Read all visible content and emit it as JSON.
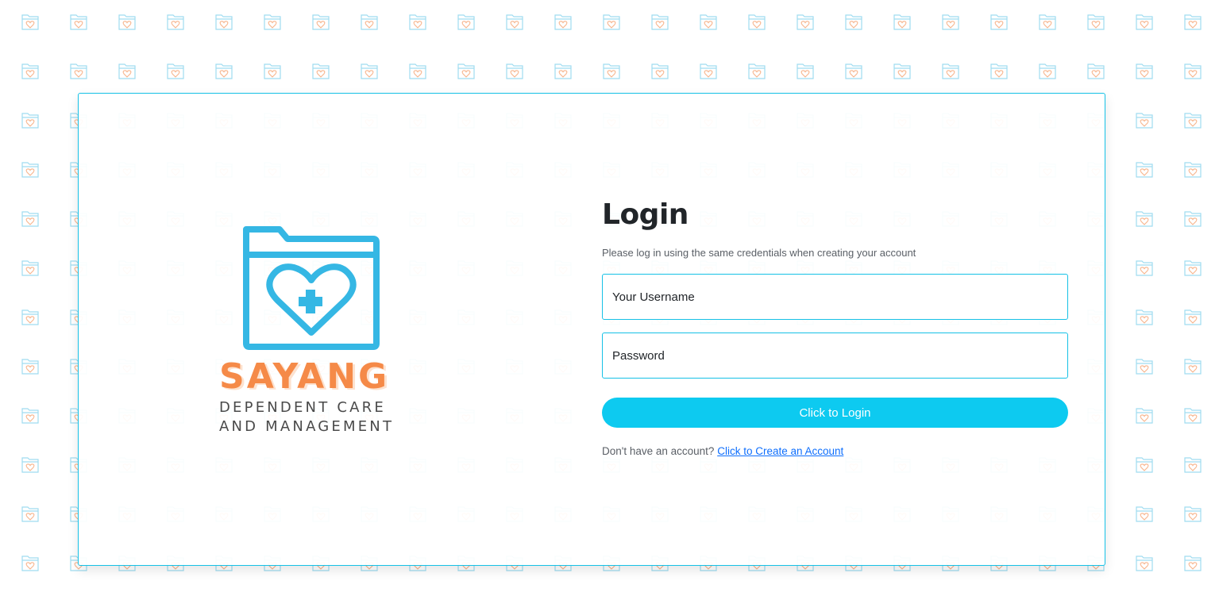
{
  "brand": {
    "name": "SAYANG",
    "tagline_line1": "DEPENDENT CARE",
    "tagline_line2": "AND MANAGEMENT",
    "logo_icon": "folder-heart-medical-icon",
    "primary_color": "#35b7e4",
    "accent_color": "#f58a48"
  },
  "background": {
    "pattern_icon": "folder-heart-icon"
  },
  "login": {
    "title": "Login",
    "subtitle": "Please log in using the same credentials when creating your account",
    "username_placeholder": "Your Username",
    "username_value": "",
    "password_placeholder": "Password",
    "password_value": "",
    "button_label": "Click to Login",
    "signup_prompt": "Don't have an account?",
    "signup_link": "Click to Create an Account"
  },
  "colors": {
    "border": "#16c1e6",
    "button": "#0dcaf0",
    "link": "#0d6efd"
  }
}
